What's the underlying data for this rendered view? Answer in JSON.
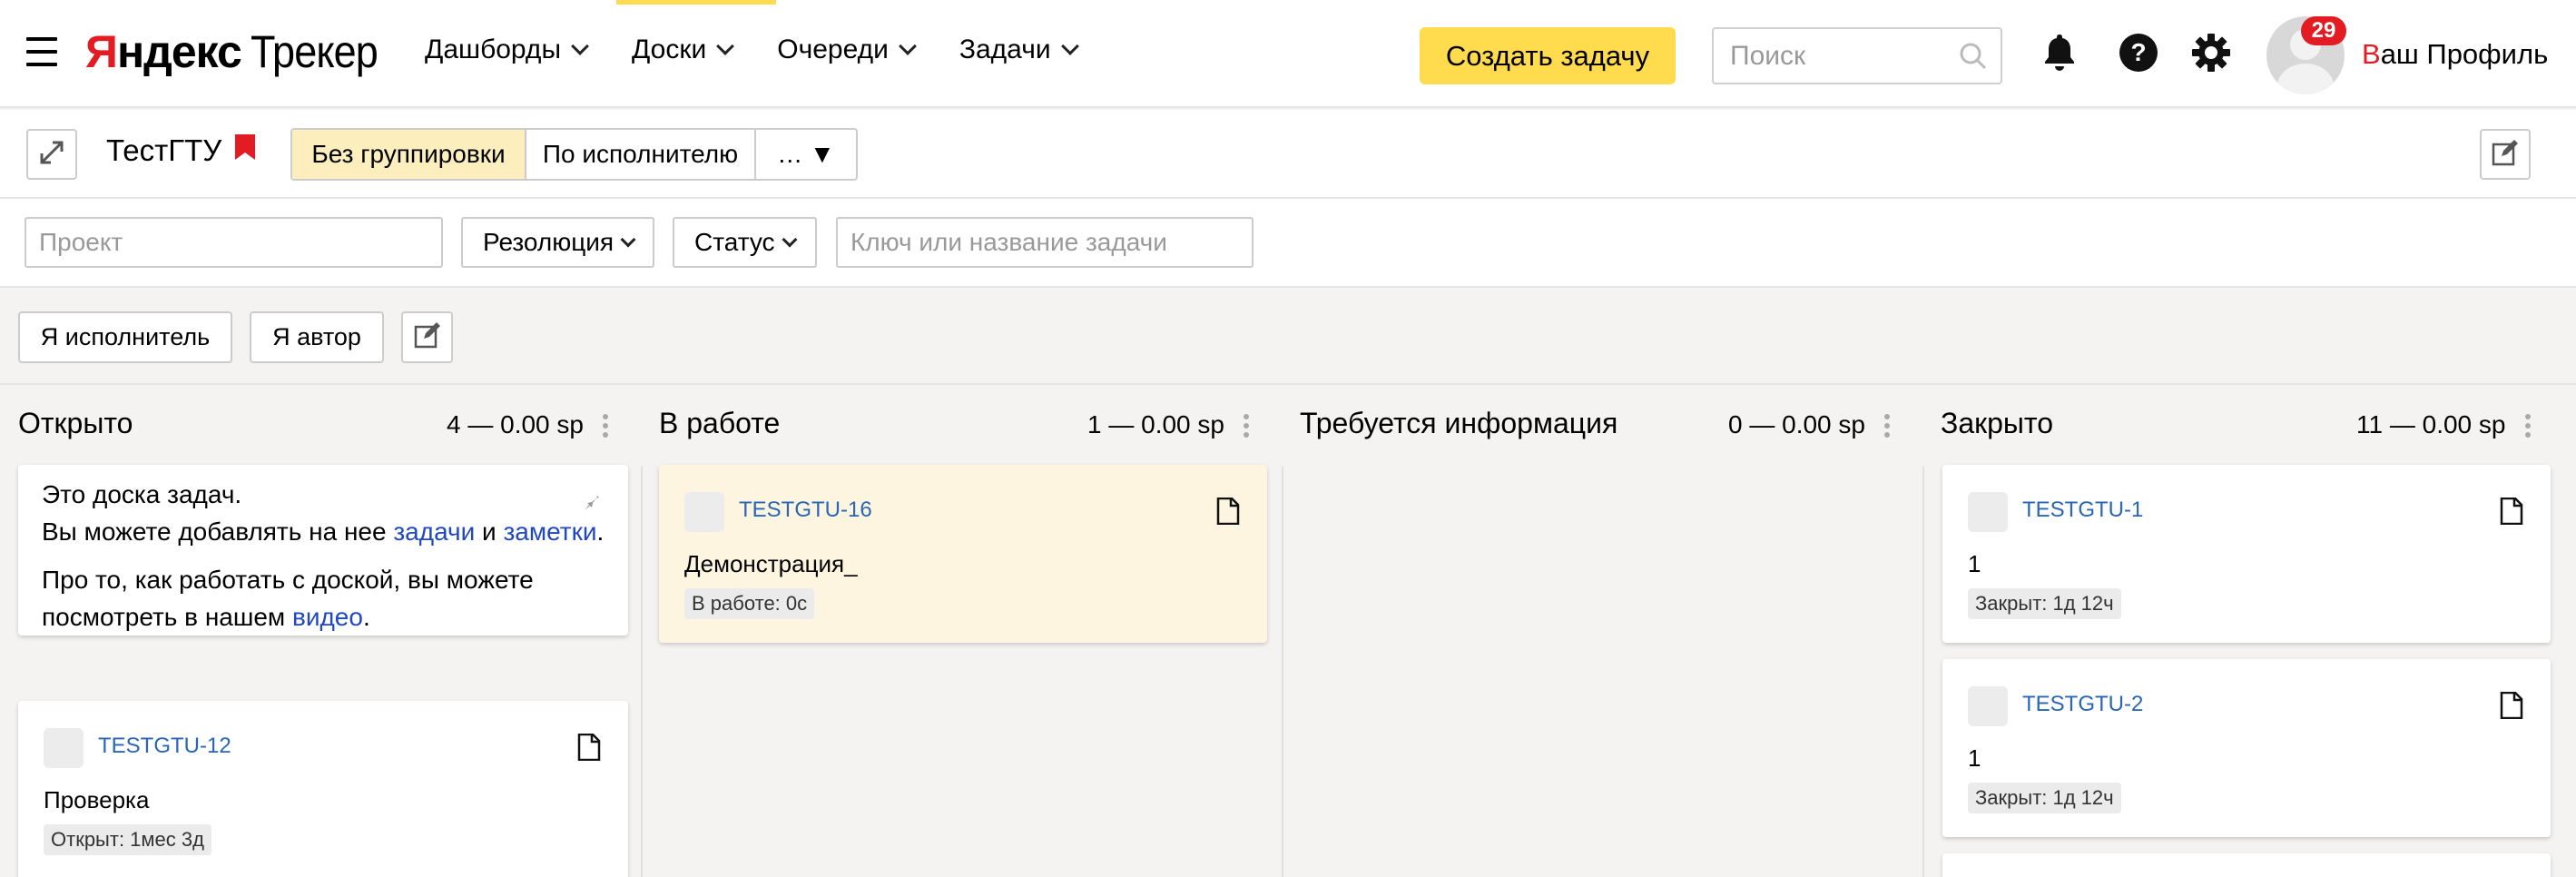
{
  "header": {
    "logo_first": "Я",
    "logo_rest": "ндекс",
    "logo_product": "Трекер",
    "menu": [
      {
        "label": "Дашборды"
      },
      {
        "label": "Доски"
      },
      {
        "label": "Очереди"
      },
      {
        "label": "Задачи"
      }
    ],
    "create_button": "Создать задачу",
    "search_placeholder": "Поиск",
    "notification_count": "29",
    "profile_first": "В",
    "profile_rest": "аш Профиль"
  },
  "toolbar": {
    "board_title": "ТестГТУ",
    "grouping": [
      {
        "label": "Без группировки",
        "active": true
      },
      {
        "label": "По исполнителю",
        "active": false
      },
      {
        "label": "… ▼",
        "active": false
      }
    ]
  },
  "filters": {
    "project_placeholder": "Проект",
    "resolution_label": "Резолюция",
    "status_label": "Статус",
    "key_placeholder": "Ключ или название задачи"
  },
  "quick_filters": {
    "me_assignee": "Я исполнитель",
    "me_author": "Я автор"
  },
  "columns": [
    {
      "title": "Открыто",
      "count": "4 — 0.00 sp",
      "info": {
        "line1": "Это доска задач.",
        "line2_prefix": "Вы можете добавлять на нее ",
        "line2_link1": "задачи",
        "line2_mid": " и ",
        "line2_link2": "заметки",
        "line2_suffix": ".",
        "line3": "Про то, как работать с доской, вы можете",
        "line4_prefix": "посмотреть в нашем ",
        "line4_link": "видео",
        "line4_suffix": "."
      },
      "cards": [
        {
          "key": "TESTGTU-12",
          "name": "Проверка",
          "status": "Открыт: 1мес 3д"
        }
      ]
    },
    {
      "title": "В работе",
      "count": "1 — 0.00 sp",
      "cards": [
        {
          "key": "TESTGTU-16",
          "name": "Демонстрация_",
          "status": "В работе: 0с"
        }
      ]
    },
    {
      "title": "Требуется информация",
      "count": "0 — 0.00 sp",
      "cards": []
    },
    {
      "title": "Закрыто",
      "count": "11 — 0.00 sp",
      "cards": [
        {
          "key": "TESTGTU-1",
          "name": "1",
          "status": "Закрыт: 1д 12ч"
        },
        {
          "key": "TESTGTU-2",
          "name": "1",
          "status": "Закрыт: 1д 12ч"
        }
      ]
    }
  ],
  "colors": {
    "accent_yellow": "#ffdb4d",
    "brand_red": "#e31b23",
    "link_blue": "#2966b7",
    "highlight_card": "#fdf5df",
    "active_segment": "#fdefbd"
  }
}
